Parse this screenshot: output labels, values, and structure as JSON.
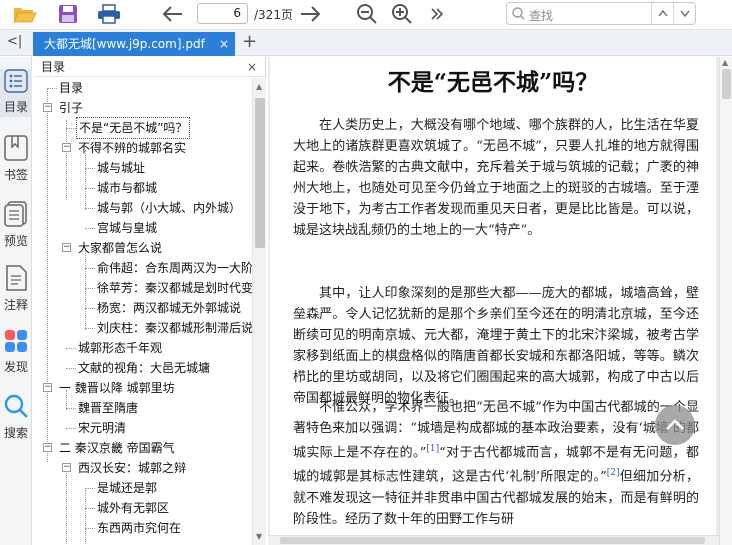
{
  "toolbar": {
    "page_input": "6",
    "page_total": "/321页",
    "search_placeholder": "查找",
    "icons": [
      "open-folder-icon",
      "save-icon",
      "print-icon",
      "prev-page-icon",
      "next-page-icon",
      "zoom-out-icon",
      "zoom-in-icon",
      "more-icon",
      "search-icon",
      "search-prev-icon",
      "search-next-icon"
    ]
  },
  "tabs": {
    "collapse_glyph": "<|",
    "active_title": "大都无城[www.j9p.com].pdf",
    "close_glyph": "×",
    "add_glyph": "+"
  },
  "rail": [
    {
      "label": "目录",
      "icon": "toc-icon"
    },
    {
      "label": "书签",
      "icon": "bookmark-icon"
    },
    {
      "label": "预览",
      "icon": "thumbnails-icon"
    },
    {
      "label": "注释",
      "icon": "annotation-icon"
    },
    {
      "label": "发现",
      "icon": "discover-icon"
    },
    {
      "label": "搜索",
      "icon": "search-icon"
    }
  ],
  "outline": {
    "header": "目录",
    "close_glyph": "×",
    "items": [
      {
        "label": "目录"
      },
      {
        "label": "引子"
      },
      {
        "label": "不是“无邑不城”吗？"
      },
      {
        "label": "不得不辨的城郭名实"
      },
      {
        "label": "城与城址"
      },
      {
        "label": "城市与都城"
      },
      {
        "label": "城与郭（小大城、内外城）"
      },
      {
        "label": "宫城与皇城"
      },
      {
        "label": "大家都曾怎么说"
      },
      {
        "label": "俞伟超：合东周两汉为一大阶"
      },
      {
        "label": "徐苹芳：秦汉都城是划时代变"
      },
      {
        "label": "杨宽：两汉都城无外郭城说"
      },
      {
        "label": "刘庆柱：秦汉都城形制滞后说"
      },
      {
        "label": "城郭形态千年观"
      },
      {
        "label": "文献的视角：大邑无城墉"
      },
      {
        "label": "一 魏晋以降 城郭里坊"
      },
      {
        "label": "魏晋至隋唐"
      },
      {
        "label": "宋元明清"
      },
      {
        "label": "二 秦汉京畿 帝国霸气"
      },
      {
        "label": "西汉长安：城郭之辩"
      },
      {
        "label": "是城还是郭"
      },
      {
        "label": "城外有无郭区"
      },
      {
        "label": "东西两市究何在"
      }
    ]
  },
  "document": {
    "title": "不是“无邑不城”吗？",
    "p1": "在人类历史上，大概没有哪个地域、哪个族群的人，比生活在华夏大地上的诸族群更喜欢筑城了。“无邑不城”，只要人扎堆的地方就得围起来。卷帙浩繁的古典文献中，充斥着关于城与筑城的记载；广袤的神州大地上，也随处可见至今仍耸立于地面之上的斑驳的古城墙。至于湮没于地下，为考古工作者发现而重见天日者，更是比比皆是。可以说，城是这块战乱频仍的土地上的一大“特产”。",
    "p2": "其中，让人印象深刻的是那些大都——庞大的都城，城墙高耸，壁垒森严。令人记忆犹新的是那个乡亲们至今还在的明清北京城，至今还断续可见的明南京城、元大都，淹埋于黄土下的北宋汴梁城，被考古学家移到纸面上的棋盘格似的隋唐首都长安城和东都洛阳城，等等。鳞次栉比的里坊或胡同，以及将它们圈围起来的高大城郭，构成了中古以后帝国都城最鲜明的物化表征。",
    "p3a": "不惟公众，学术界一般也把“无邑不城”作为中国古代都城的一个显著特色来加以强调：“城墙是构成都城的基本政治要素，没有‘城墙’的都城实际上是不存在的。”",
    "note1": "[1]",
    "p3b": "“对于古代都城而言，城郭不是有无问题，都城的城郭是其标志性建筑，这是古代‘礼制’所限定的。”",
    "note2": "[2]",
    "p3c": "但细加分析，就不难发现这一特征并非贯串中国古代都城发展的始末，而是有鲜明的阶段性。经历了数十年的田野工作与研"
  }
}
